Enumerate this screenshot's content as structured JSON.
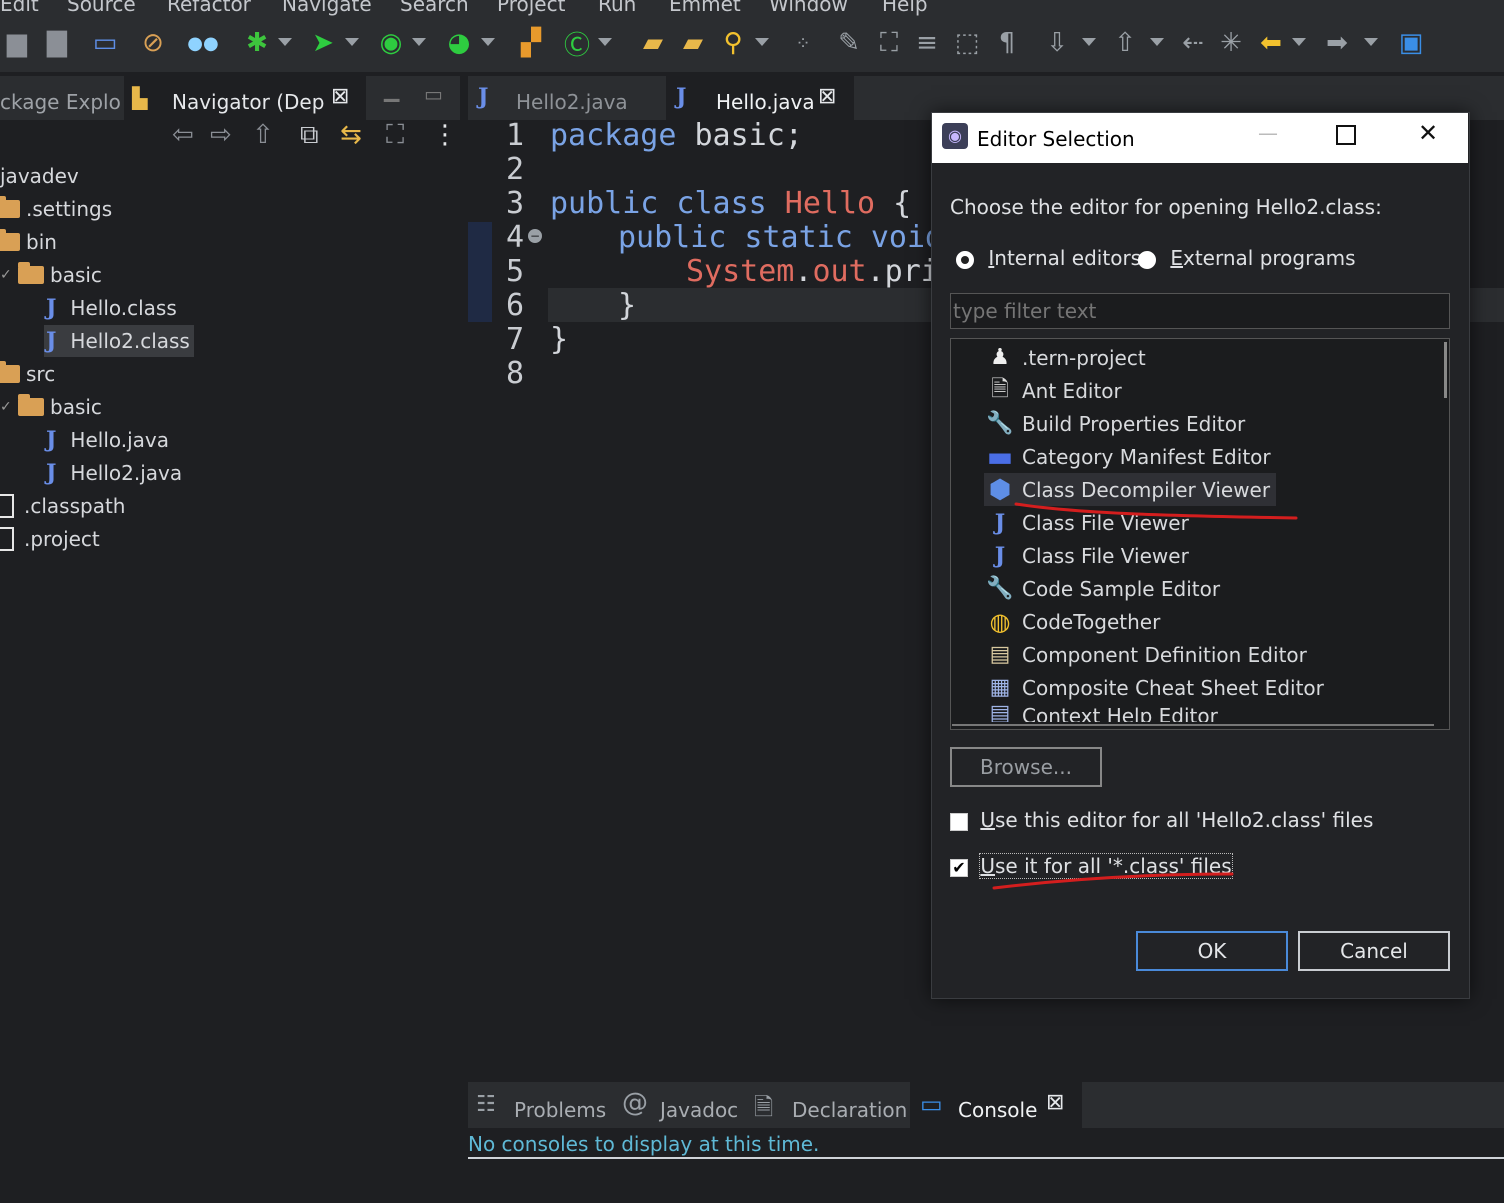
{
  "menu": [
    "Edit",
    "Source",
    "Refactor",
    "Navigate",
    "Search",
    "Project",
    "Run",
    "Emmet",
    "Window",
    "Help"
  ],
  "toolbar_icons": [
    "save-icon",
    "save-all-icon",
    "monitor-icon",
    "skip-breakpoints-icon",
    "debug-icon",
    "run-icon",
    "run-coverage-icon",
    "external-tools-icon",
    "new-java-package-icon",
    "new-java-class-icon",
    "open-type-icon",
    "open-task-icon",
    "search-icon",
    "toggle-mark-occurrences-icon",
    "edit-icon",
    "block-selection-icon",
    "word-wrap-icon",
    "show-whitespace-icon",
    "pilcrow-icon",
    "next-annotation-icon",
    "previous-annotation-icon",
    "last-edit-location-icon",
    "back-icon",
    "forward-icon",
    "perspective-icon"
  ],
  "left_tabs": {
    "package_explorer": "ckage Explo",
    "navigator": "Navigator (Dep"
  },
  "tree": [
    {
      "label": "javadev",
      "kind": "project",
      "depth": 0
    },
    {
      "label": ".settings",
      "kind": "folder",
      "depth": 0
    },
    {
      "label": "bin",
      "kind": "folder",
      "depth": 0
    },
    {
      "label": "basic",
      "kind": "folder",
      "depth": 1
    },
    {
      "label": "Hello.class",
      "kind": "java",
      "depth": 2
    },
    {
      "label": "Hello2.class",
      "kind": "java",
      "depth": 2,
      "selected": true
    },
    {
      "label": "src",
      "kind": "folder",
      "depth": 0
    },
    {
      "label": "basic",
      "kind": "folder",
      "depth": 1
    },
    {
      "label": "Hello.java",
      "kind": "java",
      "depth": 2
    },
    {
      "label": "Hello2.java",
      "kind": "java",
      "depth": 2
    },
    {
      "label": ".classpath",
      "kind": "file",
      "depth": 0
    },
    {
      "label": ".project",
      "kind": "file",
      "depth": 0
    }
  ],
  "editor_tabs": [
    {
      "label": "Hello2.java",
      "active": false
    },
    {
      "label": "Hello.java",
      "active": true
    }
  ],
  "code": {
    "line_numbers": [
      "1",
      "2",
      "3",
      "4",
      "5",
      "6",
      "7",
      "8"
    ],
    "l1_kw": "package",
    "l1_rest": " basic;",
    "l3_kw": "public class",
    "l3_cls": " Hello",
    "l3_rest": " {",
    "l4_kw": "public static void",
    "l5_cls": "System",
    "l5_dot1": ".",
    "l5_out": "out",
    "l5_rest": ".prin",
    "l6": "}",
    "l7": "}"
  },
  "console_tabs": {
    "problems": "Problems",
    "javadoc": "Javadoc",
    "declaration": "Declaration",
    "console": "Console"
  },
  "console_message": "No consoles to display at this time.",
  "dialog": {
    "title": "Editor Selection",
    "prompt": "Choose the editor for opening Hello2.class:",
    "internal_prefix": "I",
    "internal_rest": "nternal editors",
    "external_prefix": "E",
    "external_rest": "xternal programs",
    "filter_placeholder": "type filter text",
    "editors": [
      {
        "label": ".tern-project",
        "icon": "tern-penguin-icon"
      },
      {
        "label": "Ant Editor",
        "icon": "ant-icon"
      },
      {
        "label": "Build Properties Editor",
        "icon": "properties-file-icon"
      },
      {
        "label": "Category Manifest Editor",
        "icon": "category-icon"
      },
      {
        "label": "Class Decompiler Viewer",
        "icon": "decompiler-cube-icon",
        "selected": true
      },
      {
        "label": "Class File Viewer",
        "icon": "java-j-icon"
      },
      {
        "label": "Class File Viewer",
        "icon": "java-j-icon"
      },
      {
        "label": "Code Sample Editor",
        "icon": "code-sample-icon"
      },
      {
        "label": "CodeTogether",
        "icon": "codetogether-icon"
      },
      {
        "label": "Component Definition Editor",
        "icon": "component-icon"
      },
      {
        "label": "Composite Cheat Sheet Editor",
        "icon": "cheat-sheet-icon"
      },
      {
        "label": "Context Help Editor",
        "icon": "context-help-icon"
      }
    ],
    "browse": "Browse...",
    "use_this_prefix": "U",
    "use_this_rest": "se this editor for all 'Hello2.class' files",
    "use_it_prefix": "U",
    "use_it_rest": "se it for all '*.class' files",
    "ok": "OK",
    "cancel": "Cancel",
    "annotation_color": "#d41e1e"
  }
}
